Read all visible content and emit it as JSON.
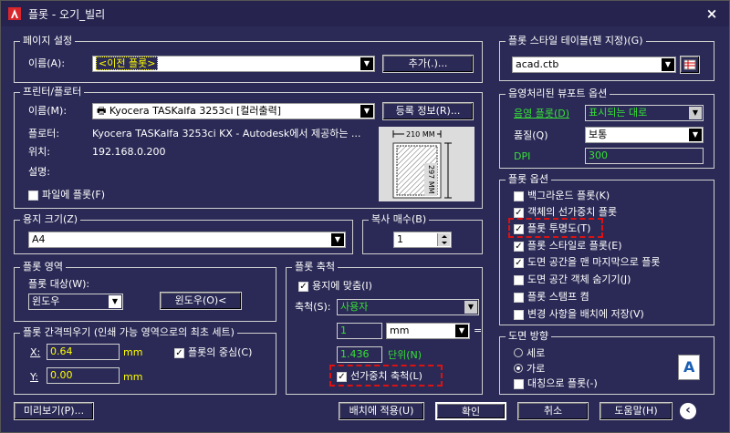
{
  "window": {
    "title": "플롯 - 오기_빌리",
    "close": "×"
  },
  "page_setup": {
    "group": "페이지 설정",
    "name_label": "이름(A):",
    "name_value": "<이전 플롯>",
    "add_button": "추가(.)..."
  },
  "printer": {
    "group": "프린터/플로터",
    "name_label": "이름(M):",
    "name_value": "Kyocera TASKalfa 3253ci [컬러출력]",
    "properties_button": "등록 정보(R)...",
    "plotter_label": "플로터:",
    "plotter_value": "Kyocera TASKalfa 3253ci KX - Autodesk에서 제공하는 ...",
    "location_label": "위치:",
    "location_value": "192.168.0.200",
    "description_label": "설명:",
    "plot_to_file": "파일에 플롯(F)",
    "preview_width": "210 MM",
    "preview_height": "297 MM"
  },
  "paper_size": {
    "group": "용지 크기(Z)",
    "value": "A4"
  },
  "copies": {
    "group": "복사 매수(B)",
    "value": "1"
  },
  "plot_area": {
    "group": "플롯 영역",
    "target_label": "플롯 대상(W):",
    "target_value": "윈도우",
    "window_button": "윈도우(O)<"
  },
  "plot_offset": {
    "group": "플롯 간격띄우기 (인쇄 가능 영역으로의 최초 세트)",
    "x_label": "X:",
    "x_value": "0.64",
    "y_label": "Y:",
    "y_value": "0.00",
    "unit": "mm",
    "center_plot": "플롯의 중심(C)"
  },
  "plot_scale": {
    "group": "플롯 축척",
    "fit_to_paper": "용지에 맞춤(I)",
    "scale_label": "축척(S):",
    "scale_value": "사용자",
    "value1": "1",
    "unit_value": "mm",
    "equals": "=",
    "value2": "1.436",
    "unit_label": "단위(N)",
    "scale_lineweights": "선가중치 축척(L)"
  },
  "plot_style_table": {
    "group": "플롯 스타일 테이블(펜 지정)(G)",
    "value": "acad.ctb"
  },
  "shaded_viewport": {
    "group": "음영처리된 뷰포트 옵션",
    "shade_label": "음영 플롯(D)",
    "shade_value": "표시되는 대로",
    "quality_label": "품질(Q)",
    "quality_value": "보통",
    "dpi_label": "DPI",
    "dpi_value": "300"
  },
  "plot_options": {
    "group": "플롯 옵션",
    "items": [
      {
        "label": "백그라운드 플롯(K)",
        "checked": false
      },
      {
        "label": "객체의 선가중치 플롯",
        "checked": true
      },
      {
        "label": "플롯 투명도(T)",
        "checked": true
      },
      {
        "label": "플롯 스타일로 플롯(E)",
        "checked": true
      },
      {
        "label": "도면 공간을 맨 마지막으로 플롯",
        "checked": true
      },
      {
        "label": "도면 공간 객체 숨기기(J)",
        "checked": false
      },
      {
        "label": "플롯 스탬프 켬",
        "checked": false
      },
      {
        "label": "변경 사항을 배치에 저장(V)",
        "checked": false
      }
    ]
  },
  "orientation": {
    "group": "도면 방향",
    "portrait": "세로",
    "landscape": "가로",
    "upside_down": "대칭으로 플롯(-)",
    "glyph": "A"
  },
  "footer": {
    "preview": "미리보기(P)...",
    "apply": "배치에 적용(U)",
    "ok": "확인",
    "cancel": "취소",
    "help": "도움말(H)",
    "collapse": "‹"
  },
  "colors": {
    "background": "#2b2a56",
    "highlight": "#ffff00",
    "green": "#35e035",
    "annotation": "#dd1111"
  }
}
